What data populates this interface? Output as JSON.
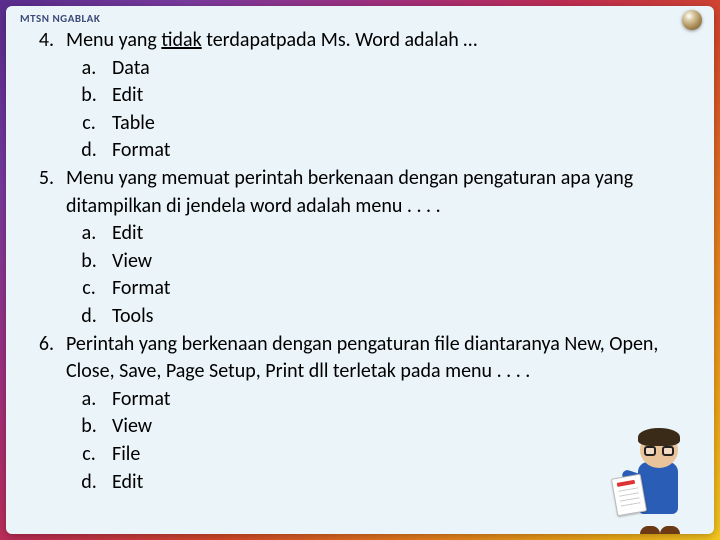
{
  "header": {
    "label": "MTSN NGABLAK"
  },
  "questions": [
    {
      "num": "4.",
      "text_pre": "Menu yang ",
      "text_underline": "tidak",
      "text_post": " terdapatpada Ms. Word adalah …",
      "options": [
        {
          "letter": "a.",
          "text": "Data"
        },
        {
          "letter": "b.",
          "text": "Edit"
        },
        {
          "letter": "c.",
          "text": "Table"
        },
        {
          "letter": "d.",
          "text": "Format"
        }
      ]
    },
    {
      "num": "5.",
      "text": "Menu yang memuat perintah berkenaan dengan pengaturan apa yang ditampilkan di jendela word adalah menu . . . .",
      "options": [
        {
          "letter": "a.",
          "text": "Edit"
        },
        {
          "letter": "b.",
          "text": "View"
        },
        {
          "letter": "c.",
          "text": "Format"
        },
        {
          "letter": "d.",
          "text": "Tools"
        }
      ]
    },
    {
      "num": "6.",
      "text": "Perintah yang berkenaan dengan pengaturan file diantaranya New, Open, Close, Save, Page Setup, Print dll terletak pada menu . . . .",
      "options": [
        {
          "letter": "a.",
          "text": "Format"
        },
        {
          "letter": "b.",
          "text": "View"
        },
        {
          "letter": "c.",
          "text": "File"
        },
        {
          "letter": "d.",
          "text": "Edit"
        }
      ]
    }
  ]
}
